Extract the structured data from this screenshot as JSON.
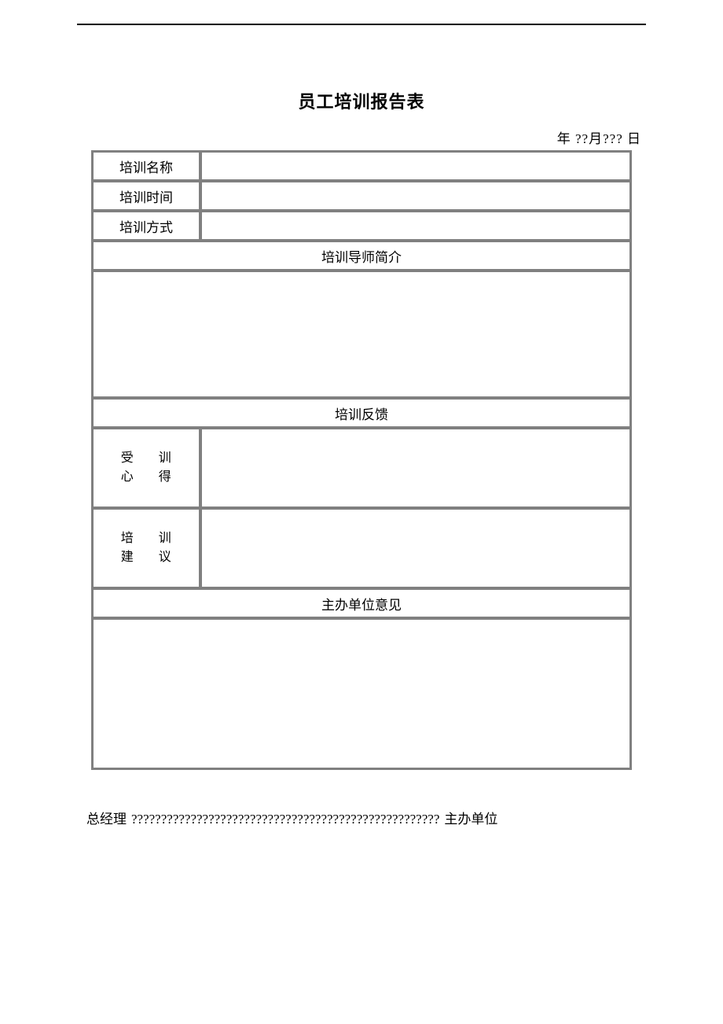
{
  "title": "员工培训报告表",
  "date_line": "年 ??月???  日",
  "rows": {
    "training_name_label": "培训名称",
    "training_name_value": "",
    "training_time_label": "培训时间",
    "training_time_value": "",
    "training_method_label": "培训方式",
    "training_method_value": ""
  },
  "sections": {
    "instructor_intro": "培训导师简介",
    "feedback": "培训反馈",
    "organizer_opinion": "主办单位意见"
  },
  "feedback_rows": {
    "trainee_notes_l1a": "受",
    "trainee_notes_l1b": "训",
    "trainee_notes_l2a": "心",
    "trainee_notes_l2b": "得",
    "suggestion_l1a": "培",
    "suggestion_l1b": "训",
    "suggestion_l2a": "建",
    "suggestion_l2b": "议"
  },
  "footer": {
    "gm_label": "总经理",
    "placeholder": "????????????????????????????????????????????????????",
    "org_label": "主办单位"
  }
}
